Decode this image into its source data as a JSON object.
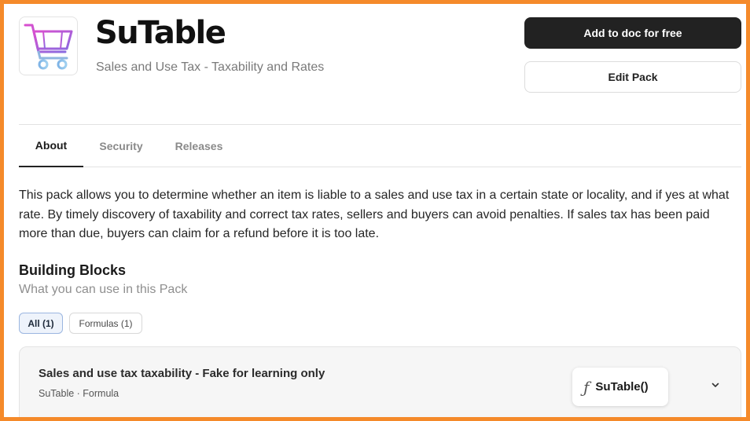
{
  "header": {
    "title": "SuTable",
    "subtitle": "Sales and Use Tax - Taxability and Rates",
    "logo_icon": "shopping-cart-icon",
    "add_button_label": "Add to doc for free",
    "edit_button_label": "Edit Pack"
  },
  "tabs": [
    {
      "label": "About",
      "active": true
    },
    {
      "label": "Security",
      "active": false
    },
    {
      "label": "Releases",
      "active": false
    }
  ],
  "about": {
    "description": "This pack allows you to determine whether an item is liable to a sales and use tax in a certain state or locality, and if yes at what rate. By timely discovery of taxability and correct tax rates, sellers and buyers can avoid penalties. If sales tax has been paid more than due, buyers can claim for a refund before it is too late."
  },
  "building_blocks": {
    "title": "Building Blocks",
    "subtitle": "What you can use in this Pack",
    "filters": [
      {
        "label": "All (1)",
        "active": true
      },
      {
        "label": "Formulas (1)",
        "active": false
      }
    ],
    "items": [
      {
        "name": "Sales and use tax taxability - Fake for learning only",
        "meta": "SuTable · Formula",
        "formula": "SuTable()",
        "formula_icon": "function-icon",
        "expand_icon": "chevron-down-icon"
      }
    ]
  },
  "colors": {
    "frame_border": "#f58a2a",
    "primary_button": "#222222",
    "active_filter_bg": "#eef3fb",
    "active_filter_border": "#9bb6e0",
    "logo_gradient_start": "#d14fd1",
    "logo_gradient_end": "#7fb4e6"
  }
}
